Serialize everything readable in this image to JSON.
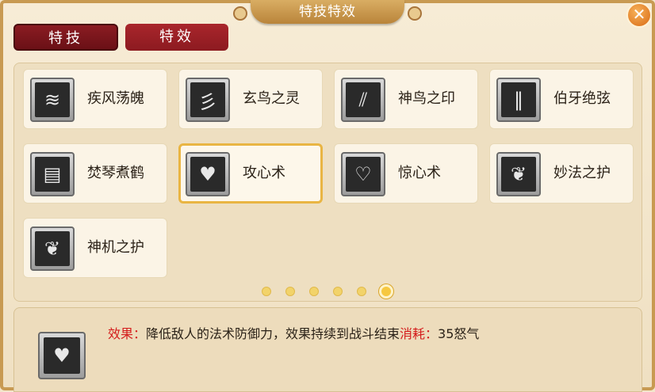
{
  "window": {
    "title": "特技特效",
    "close_label": "✕"
  },
  "tabs": [
    {
      "label": "特技",
      "active": true
    },
    {
      "label": "特效",
      "active": false
    }
  ],
  "skills": [
    {
      "name": "疾风荡魄",
      "icon": "wind-sword-icon",
      "glyph": "≋"
    },
    {
      "name": "玄鸟之灵",
      "icon": "dark-bird-icon",
      "glyph": "彡"
    },
    {
      "name": "神鸟之印",
      "icon": "divine-bird-icon",
      "glyph": "⫽"
    },
    {
      "name": "伯牙绝弦",
      "icon": "strings-icon",
      "glyph": "‖"
    },
    {
      "name": "焚琴煮鹤",
      "icon": "zither-icon",
      "glyph": "▤"
    },
    {
      "name": "攻心术",
      "icon": "broken-heart-icon",
      "glyph": "♥",
      "selected": true
    },
    {
      "name": "惊心术",
      "icon": "heart-shield-icon",
      "glyph": "♡"
    },
    {
      "name": "妙法之护",
      "icon": "feather-icon",
      "glyph": "❦"
    },
    {
      "name": "神机之护",
      "icon": "feather-icon",
      "glyph": "❦"
    }
  ],
  "pagination": {
    "pages": 6,
    "current": 6
  },
  "detail": {
    "effect_label": "效果：",
    "effect_text": "降低敌人的法术防御力，效果持续到战斗结束",
    "cost_label": "消耗：",
    "cost_text": "35怒气",
    "icon": "broken-heart-icon",
    "glyph": "♥"
  },
  "colors": {
    "accent": "#e9b543",
    "tab": "#8b1c22",
    "highlight": "#d41c1c"
  }
}
